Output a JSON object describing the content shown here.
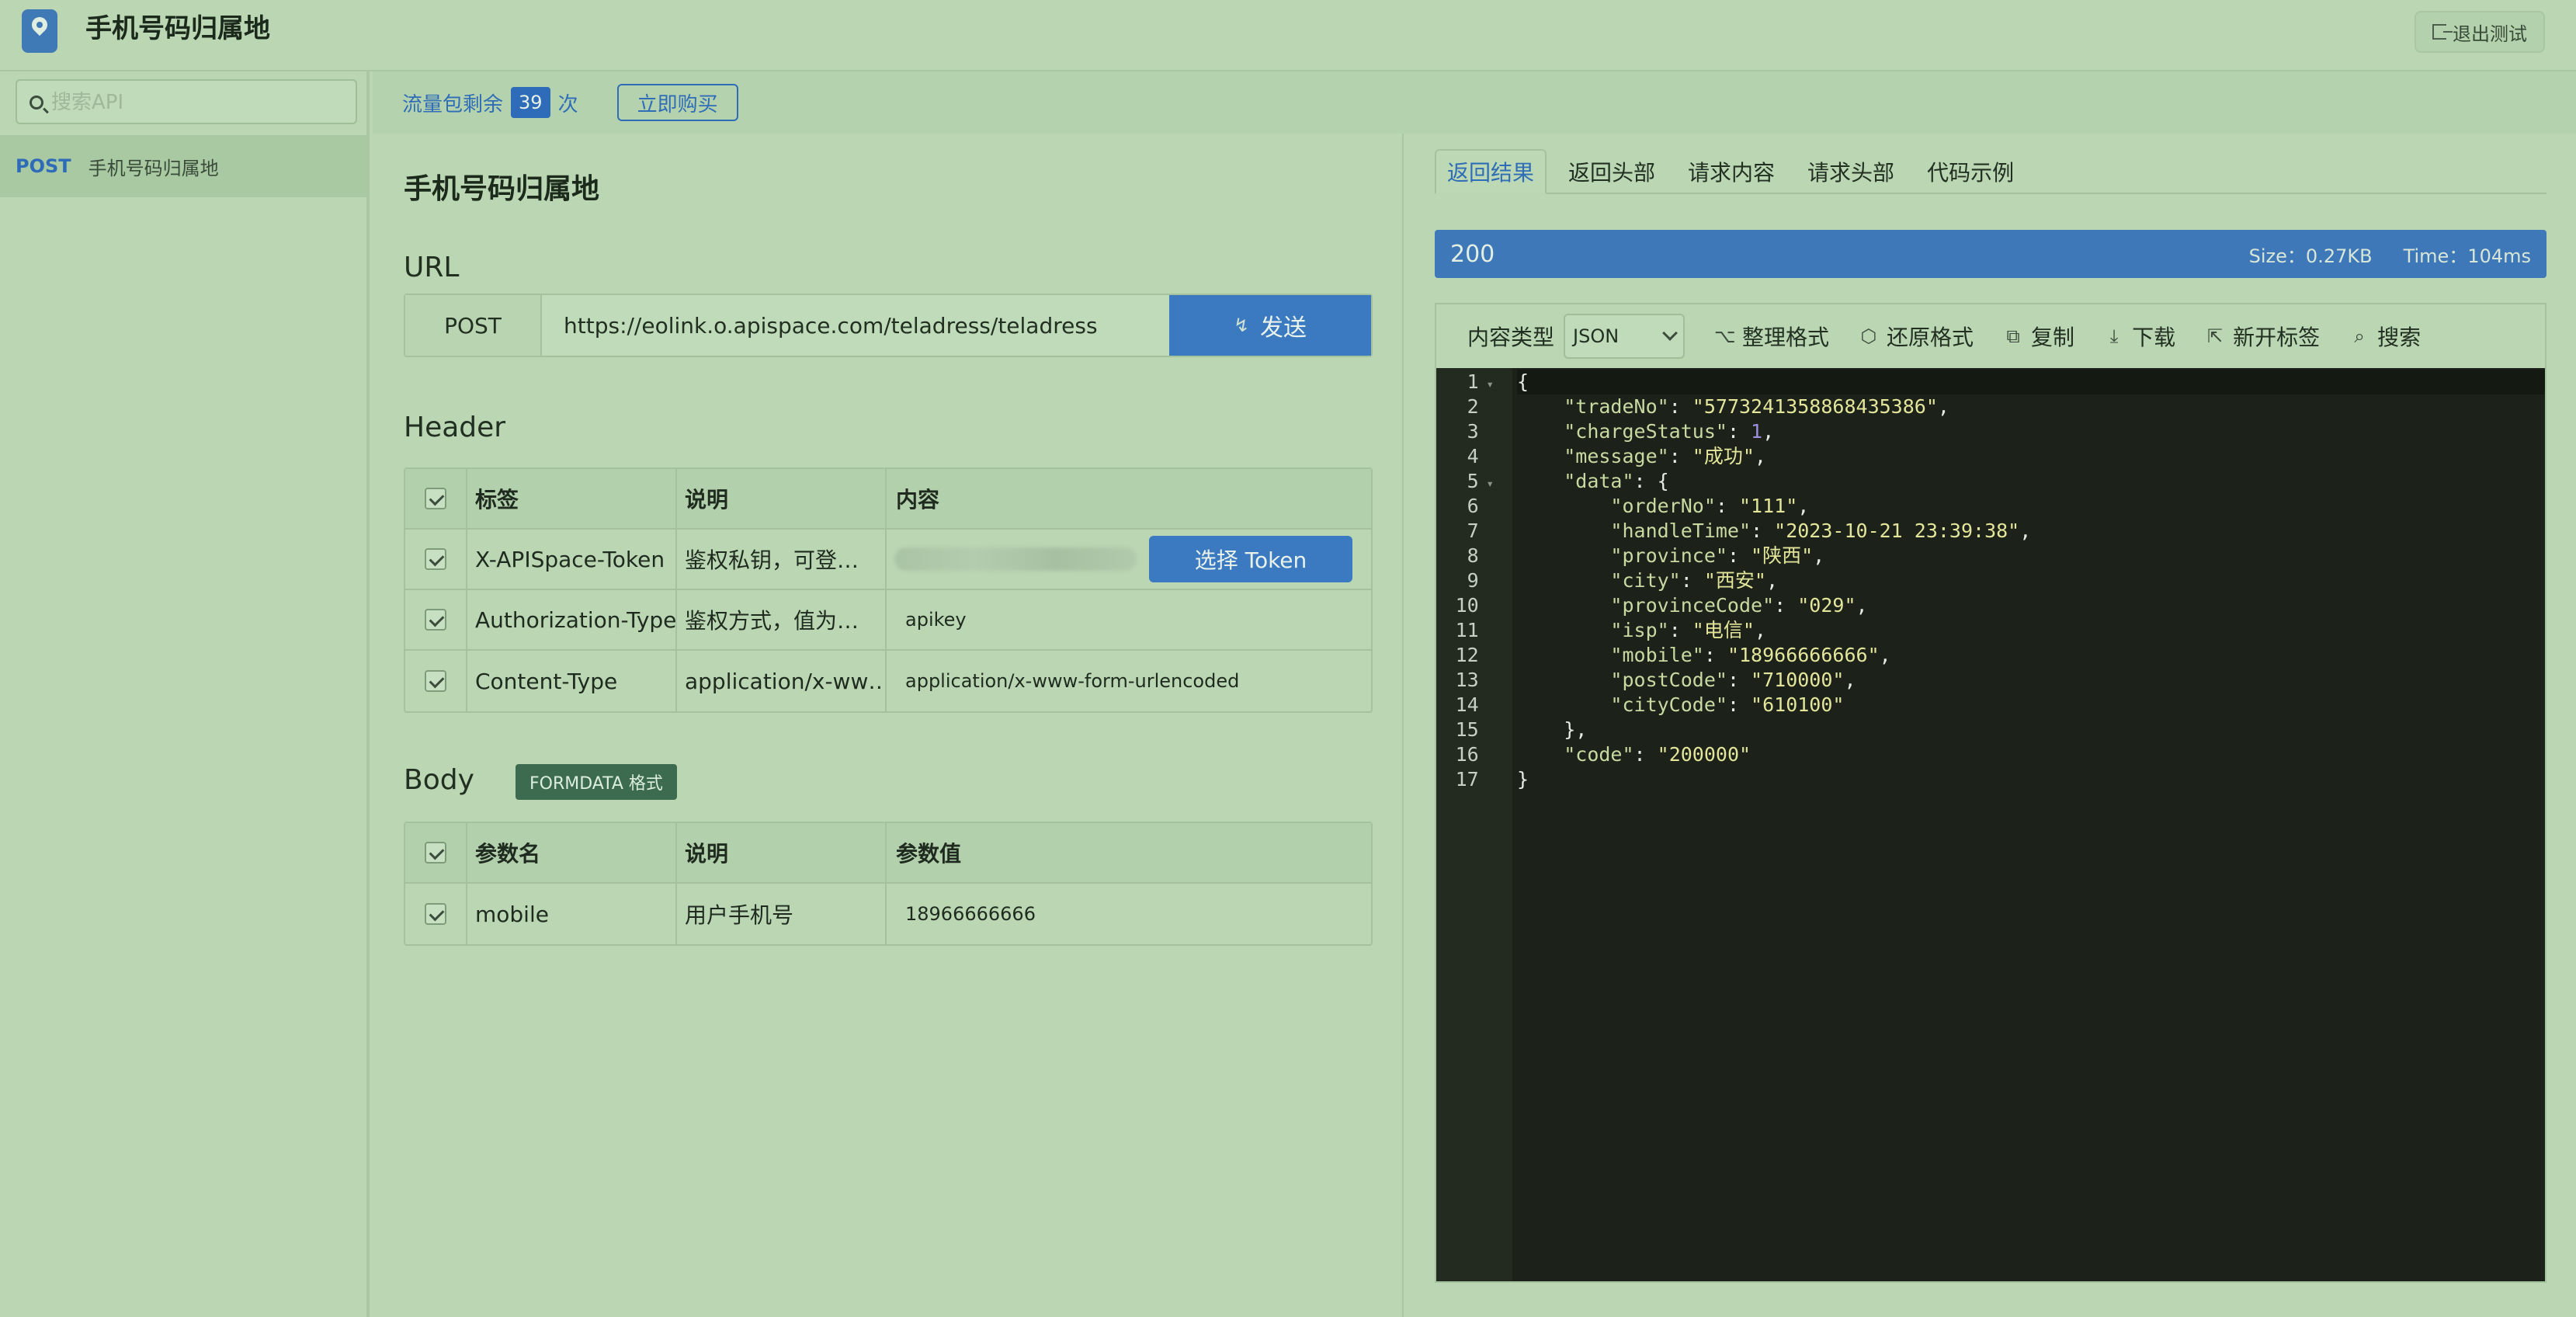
{
  "app": {
    "title": "手机号码归属地",
    "exit_label": "退出测试"
  },
  "sidebar": {
    "search_placeholder": "搜索API",
    "items": [
      {
        "method": "POST",
        "name": "手机号码归属地"
      }
    ]
  },
  "quota": {
    "label": "流量包剩余",
    "count": "39",
    "unit": "次",
    "buy_label": "立即购买"
  },
  "request": {
    "title": "手机号码归属地",
    "url_label": "URL",
    "method": "POST",
    "url": "https://eolink.o.apispace.com/teladress/teladress",
    "send_label": "发送",
    "header_label": "Header",
    "header_columns": [
      "标签",
      "说明",
      "内容"
    ],
    "header_rows": [
      {
        "name": "X-APISpace-Token",
        "desc": "鉴权私钥，可登…",
        "value": "",
        "action": "选择 Token"
      },
      {
        "name": "Authorization-Type",
        "desc": "鉴权方式，值为…",
        "value": "apikey"
      },
      {
        "name": "Content-Type",
        "desc": "application/x-ww…",
        "value": "application/x-www-form-urlencoded"
      }
    ],
    "body_label": "Body",
    "body_badge": "FORMDATA 格式",
    "body_columns": [
      "参数名",
      "说明",
      "参数值"
    ],
    "body_rows": [
      {
        "name": "mobile",
        "desc": "用户手机号",
        "value": "18966666666"
      }
    ]
  },
  "response": {
    "tabs": [
      "返回结果",
      "返回头部",
      "请求内容",
      "请求头部",
      "代码示例"
    ],
    "active_tab": 0,
    "status_code": "200",
    "size": "Size：0.27KB",
    "time": "Time：104ms",
    "toolbar": {
      "content_type_label": "内容类型",
      "content_type_value": "JSON",
      "format": "整理格式",
      "restore": "还原格式",
      "copy": "复制",
      "download": "下载",
      "new_tab": "新开标签",
      "search": "搜索"
    },
    "json": {
      "tradeNo": "5773241358868435386",
      "chargeStatus": 1,
      "message": "成功",
      "data": {
        "orderNo": "111",
        "handleTime": "2023-10-21 23:39:38",
        "province": "陕西",
        "city": "西安",
        "provinceCode": "029",
        "isp": "电信",
        "mobile": "18966666666",
        "postCode": "710000",
        "cityCode": "610100"
      },
      "code": "200000"
    }
  }
}
